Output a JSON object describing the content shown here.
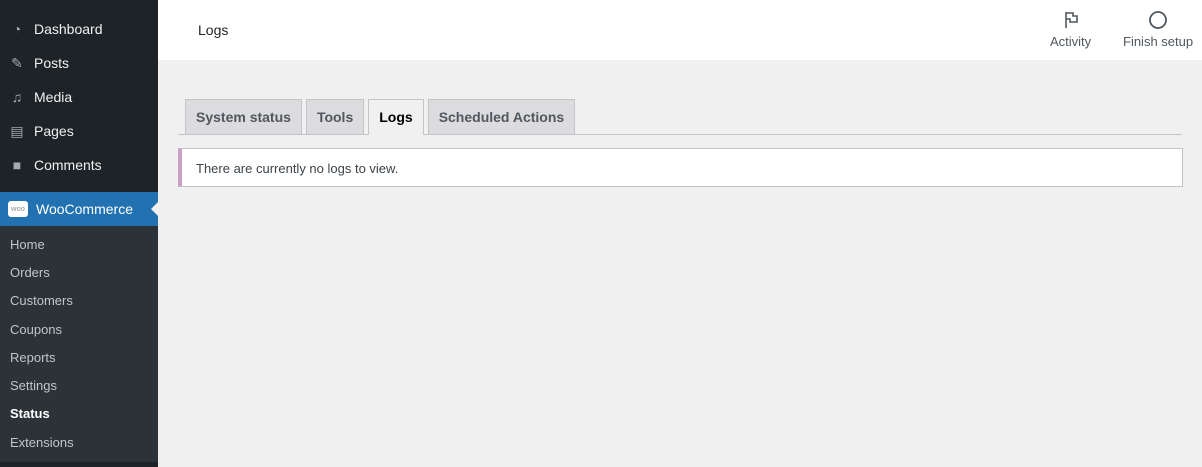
{
  "sidebar": {
    "items": [
      {
        "label": "Dashboard",
        "icon": "dashboard-icon"
      },
      {
        "label": "Posts",
        "icon": "pin-icon"
      },
      {
        "label": "Media",
        "icon": "media-icon"
      },
      {
        "label": "Pages",
        "icon": "pages-icon"
      },
      {
        "label": "Comments",
        "icon": "comment-icon"
      }
    ],
    "woo": {
      "label": "WooCommerce",
      "icon_text": "woo"
    },
    "sub": [
      "Home",
      "Orders",
      "Customers",
      "Coupons",
      "Reports",
      "Settings",
      "Status",
      "Extensions"
    ]
  },
  "header": {
    "title": "Logs",
    "activity": "Activity",
    "finish": "Finish setup"
  },
  "tabs": [
    "System status",
    "Tools",
    "Logs",
    "Scheduled Actions"
  ],
  "notice": "There are currently no logs to view.",
  "colors": {
    "accent": "#2271b1",
    "notice_border": "#c9a0c6"
  }
}
